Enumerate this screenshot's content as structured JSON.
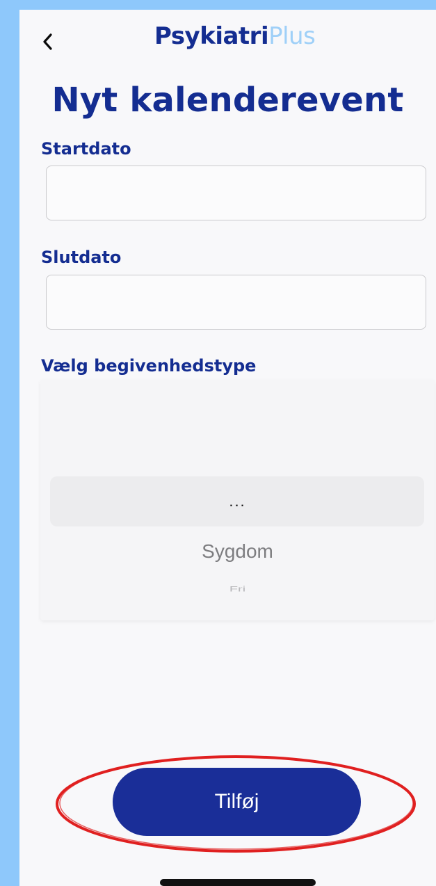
{
  "header": {
    "brand_main": "Psykiatri",
    "brand_accent": "Plus",
    "back_icon": "chevron-left-icon"
  },
  "title": "Nyt kalenderevent",
  "form": {
    "start_label": "Startdato",
    "start_value": "",
    "end_label": "Slutdato",
    "end_value": "",
    "type_label": "Vælg begivenhedstype",
    "type_options": [
      "...",
      "Sygdom",
      "Fri"
    ],
    "type_selected": "..."
  },
  "actions": {
    "add_label": "Tilføj"
  },
  "colors": {
    "primary": "#1a2e98",
    "accent_light": "#9fd0f8",
    "background": "#8ec8fb",
    "annotation": "#e02020"
  }
}
